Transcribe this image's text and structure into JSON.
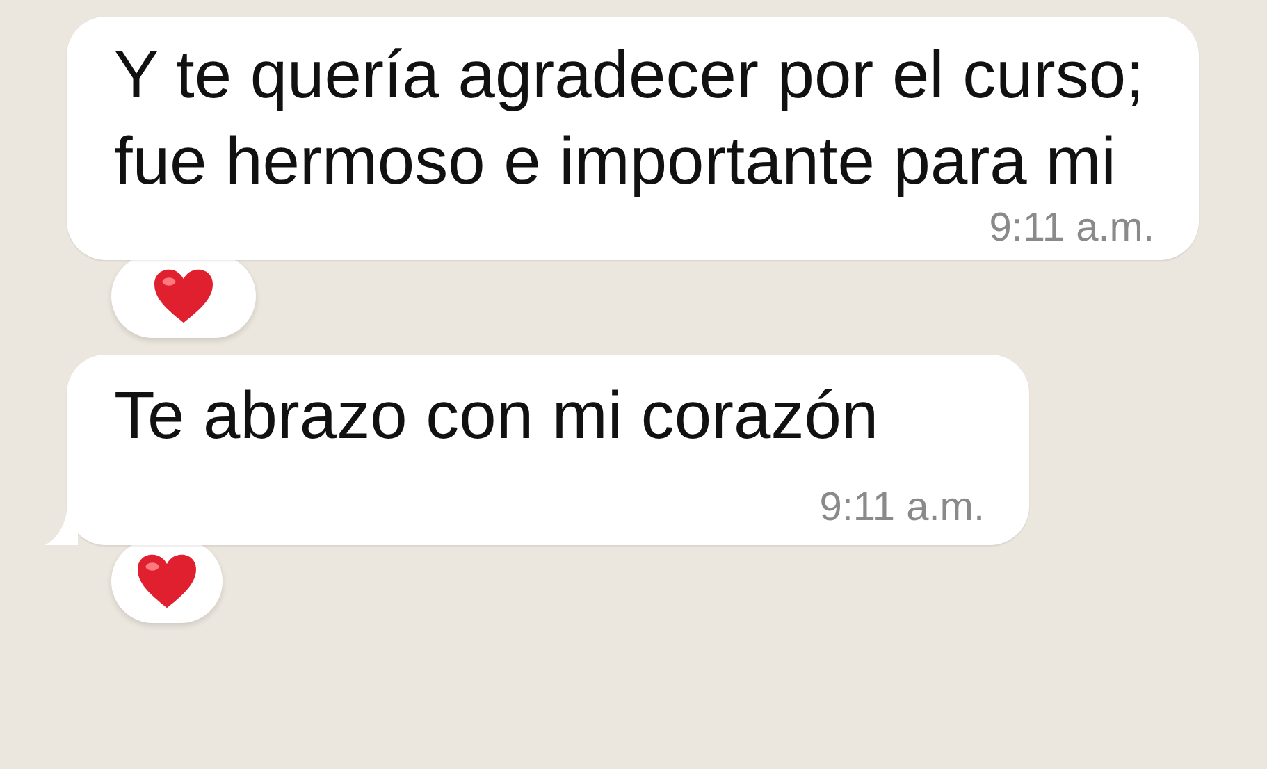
{
  "messages": [
    {
      "text": "Y te quería agradecer por el curso; fue hermoso e importante para mi",
      "time": "9:11 a.m.",
      "tail": false,
      "reactions": [
        {
          "kind": "heart"
        }
      ]
    },
    {
      "text": "Te abrazo con mi corazón",
      "time": "9:11 a.m.",
      "tail": true,
      "reactions": [
        {
          "kind": "heart"
        }
      ]
    }
  ]
}
